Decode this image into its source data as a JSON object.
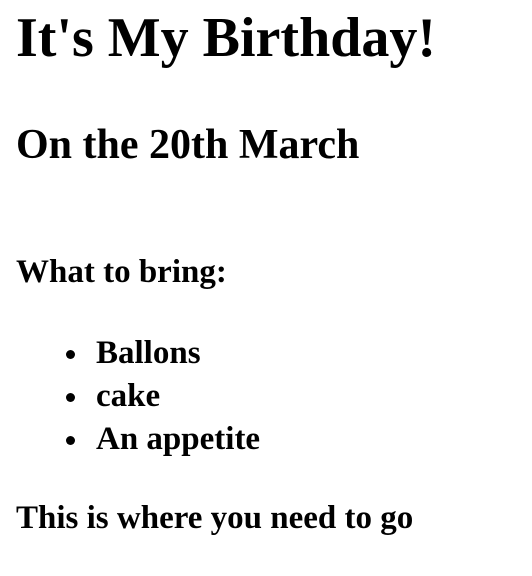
{
  "header": {
    "title": "It's My Birthday!",
    "subtitle": "On the 20th March"
  },
  "bring_section": {
    "heading": "What to bring:",
    "items": [
      {
        "label": "Ballons"
      },
      {
        "label": "cake"
      },
      {
        "label": "An appetite"
      }
    ]
  },
  "footer": {
    "text": "This is where you need to go"
  }
}
